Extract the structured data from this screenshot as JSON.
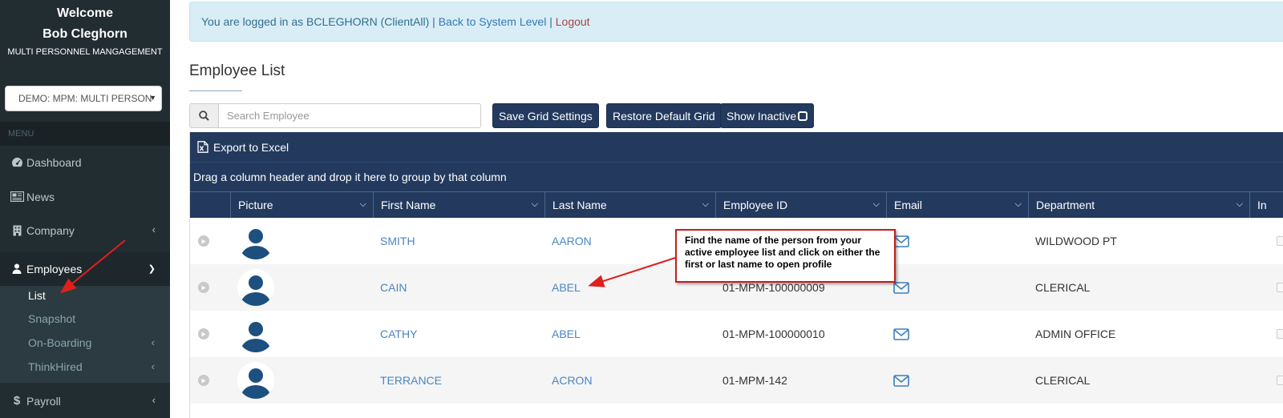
{
  "sidebar": {
    "welcome_line1": "Welcome",
    "welcome_line2": "Bob Cleghorn",
    "welcome_line3": "MULTI PERSONNEL MANGAGEMENT",
    "client_select_value": "DEMO: MPM: MULTI PERSON",
    "menu_header": "MENU",
    "items": [
      {
        "label": "Dashboard",
        "icon": "dashboard-icon"
      },
      {
        "label": "News",
        "icon": "newspaper-icon"
      },
      {
        "label": "Company",
        "icon": "building-icon"
      },
      {
        "label": "Employees",
        "icon": "user-icon"
      },
      {
        "label": "Payroll",
        "icon": "dollar-icon"
      }
    ],
    "employee_submenu": [
      "List",
      "Snapshot",
      "On-Boarding",
      "ThinkHired"
    ]
  },
  "alert": {
    "prefix": "You are logged in as BCLEGHORN (ClientAll) | ",
    "back_link": "Back to System Level",
    "separator": " | ",
    "logout_link": "Logout"
  },
  "page_title": "Employee List",
  "search": {
    "placeholder": "Search Employee"
  },
  "toolbar": {
    "save_grid": "Save Grid Settings",
    "restore_grid": "Restore Default Grid",
    "show_inactive": "Show Inactive"
  },
  "grid": {
    "export_label": "Export to Excel",
    "group_hint": "Drag a column header and drop it here to group by that column",
    "columns": [
      "Picture",
      "First Name",
      "Last Name",
      "Employee ID",
      "Email",
      "Department",
      "In"
    ],
    "rows": [
      {
        "first_name": "SMITH",
        "last_name": "AARON",
        "employee_id": "",
        "department": "WILDWOOD PT"
      },
      {
        "first_name": "CAIN",
        "last_name": "ABEL",
        "employee_id": "01-MPM-100000009",
        "department": "CLERICAL"
      },
      {
        "first_name": "CATHY",
        "last_name": "ABEL",
        "employee_id": "01-MPM-100000010",
        "department": "ADMIN OFFICE"
      },
      {
        "first_name": "TERRANCE",
        "last_name": "ACRON",
        "employee_id": "01-MPM-142",
        "department": "CLERICAL"
      }
    ]
  },
  "callout": {
    "text": "Find the name of the person from your active employee list and click on either the first or last name to open profile"
  },
  "colors": {
    "sidebar_bg": "#222d32",
    "grid_header_bg": "#233a5e",
    "alert_bg": "#d9edf7",
    "link": "#4a86c0",
    "annotation_red": "#e0201b"
  }
}
